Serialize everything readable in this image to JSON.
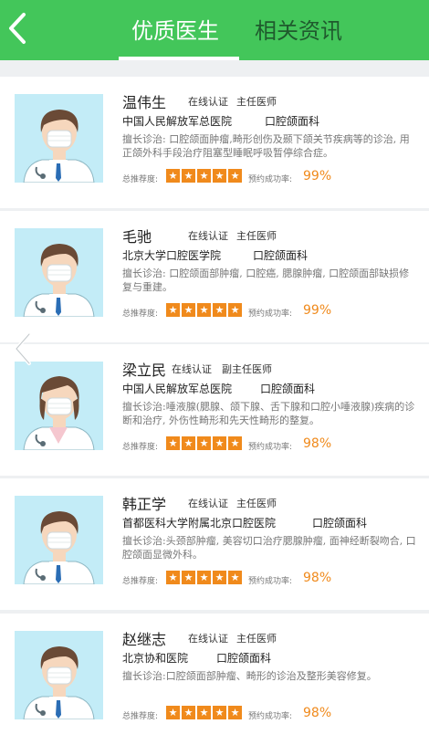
{
  "header": {
    "tabs": [
      {
        "label": "优质医生",
        "active": true
      },
      {
        "label": "相关资讯",
        "active": false
      }
    ],
    "accent_color": "#43c65a"
  },
  "labels": {
    "rating": "总推荐度:",
    "success": "预约成功率:"
  },
  "doctors": [
    {
      "name": "温伟生",
      "cert": "在线认证",
      "title": "主任医师",
      "hospital": "中国人民解放军总医院",
      "department": "口腔颌面科",
      "specialty": "擅长诊治: 口腔颌面肿瘤,畸形创伤及颞下颌关节疾病等的诊治, 用正颌外科手段治疗阻塞型睡眠呼吸暂停综合症。",
      "stars": 5,
      "success_rate": "99%",
      "gender": "male"
    },
    {
      "name": "毛驰",
      "cert": "在线认证",
      "title": "主任医师",
      "hospital": "北京大学口腔医学院",
      "department": "口腔颌面科",
      "specialty": "擅长诊治: 口腔颌面部肿瘤, 口腔癌, 腮腺肿瘤, 口腔颌面部缺损修复与重建。",
      "stars": 5,
      "success_rate": "99%",
      "gender": "male"
    },
    {
      "name": "梁立民",
      "cert": "在线认证",
      "title": "副主任医师",
      "hospital": "中国人民解放军总医院",
      "department": "口腔颌面科",
      "specialty": "擅长诊治:唾液腺(腮腺、颌下腺、舌下腺和口腔小唾液腺)疾病的诊断和治疗, 外伤性畸形和先天性畸形的整复。",
      "stars": 5,
      "success_rate": "98%",
      "gender": "female"
    },
    {
      "name": "韩正学",
      "cert": "在线认证",
      "title": "主任医师",
      "hospital": "首都医科大学附属北京口腔医院",
      "department": "口腔颌面科",
      "specialty": "擅长诊治:头颈部肿瘤, 美容切口治疗腮腺肿瘤, 面神经断裂吻合, 口腔颌面显微外科。",
      "stars": 5,
      "success_rate": "98%",
      "gender": "male"
    },
    {
      "name": "赵继志",
      "cert": "在线认证",
      "title": "主任医师",
      "hospital": "北京协和医院",
      "department": "口腔颌面科",
      "specialty": "擅长诊治:口腔颌面部肿瘤、畸形的诊治及整形美容修复。",
      "stars": 5,
      "success_rate": "98%",
      "gender": "male"
    }
  ]
}
